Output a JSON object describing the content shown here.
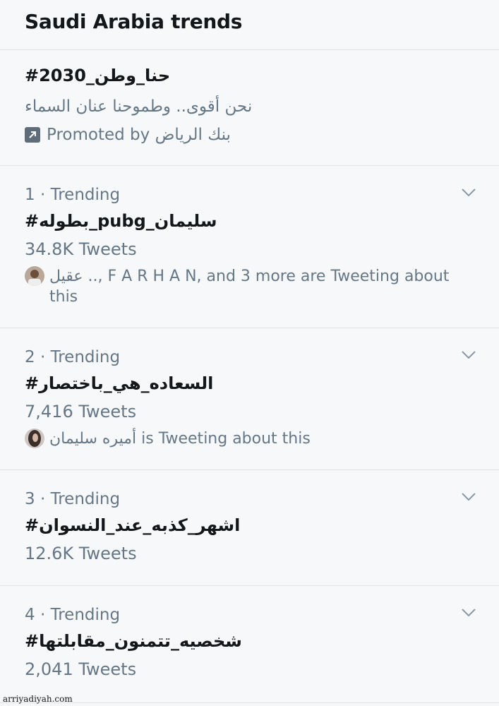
{
  "header": {
    "title": "Saudi Arabia trends"
  },
  "promoted": {
    "hashtag": "#حنا_وطن_2030",
    "description": "نحن أقوى.. وطموحنا عنان السماء",
    "promoted_label": "Promoted by بنك الرياض",
    "icon": "promoted-arrow-icon"
  },
  "trends": [
    {
      "meta": "1 · Trending",
      "hashtag": "#بطوله_pubg_سليمان",
      "count": "34.8K Tweets",
      "social": "عقيل .., F A R H A N, and 3 more are Tweeting about this"
    },
    {
      "meta": "2 · Trending",
      "hashtag": "#السعاده_هي_باختصار",
      "count": "7,416 Tweets",
      "social": "أميره سليمان is Tweeting about this"
    },
    {
      "meta": "3 · Trending",
      "hashtag": "#اشهر_كذبه_عند_النسوان",
      "count": "12.6K Tweets"
    },
    {
      "meta": "4 · Trending",
      "hashtag": "#شخصيه_تتمنون_مقابلتها",
      "count": "2,041 Tweets"
    }
  ],
  "watermark": "arriyadiyah.com",
  "colors": {
    "text": "#14171a",
    "muted": "#657786",
    "divider": "#dfe3e6",
    "background": "#f7f8f9"
  }
}
